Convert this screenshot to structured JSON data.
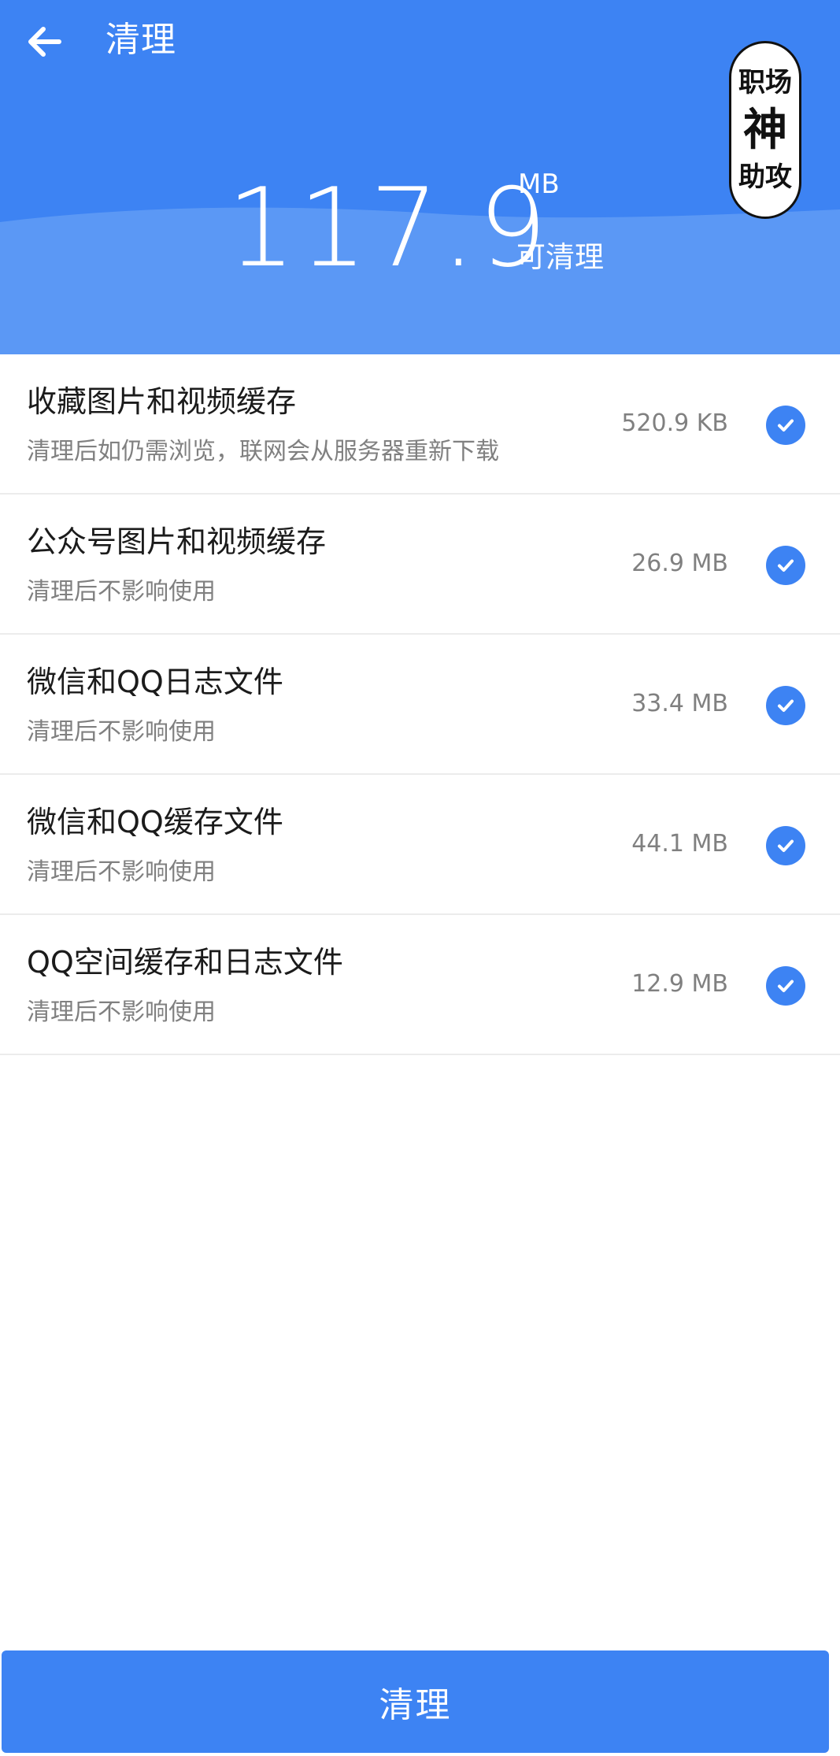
{
  "header": {
    "title": "清理",
    "amount": "117.9",
    "unit": "MB",
    "amount_label": "可清理"
  },
  "logo": {
    "line1": "职场",
    "line2": "神",
    "line3": "助攻"
  },
  "items": [
    {
      "title": "收藏图片和视频缓存",
      "subtitle": "清理后如仍需浏览，联网会从服务器重新下载",
      "size": "520.9 KB",
      "checked": true
    },
    {
      "title": "公众号图片和视频缓存",
      "subtitle": "清理后不影响使用",
      "size": "26.9 MB",
      "checked": true
    },
    {
      "title": "微信和QQ日志文件",
      "subtitle": "清理后不影响使用",
      "size": "33.4 MB",
      "checked": true
    },
    {
      "title": "微信和QQ缓存文件",
      "subtitle": "清理后不影响使用",
      "size": "44.1 MB",
      "checked": true
    },
    {
      "title": "QQ空间缓存和日志文件",
      "subtitle": "清理后不影响使用",
      "size": "12.9 MB",
      "checked": true
    }
  ],
  "footer": {
    "button_label": "清理"
  },
  "colors": {
    "primary": "#3D83F3",
    "header_light": "#5B98F5",
    "text_primary": "#1b1b1b",
    "text_secondary": "#808080"
  },
  "icons": {
    "back": "arrow-left-icon",
    "check": "check-circle-icon"
  }
}
